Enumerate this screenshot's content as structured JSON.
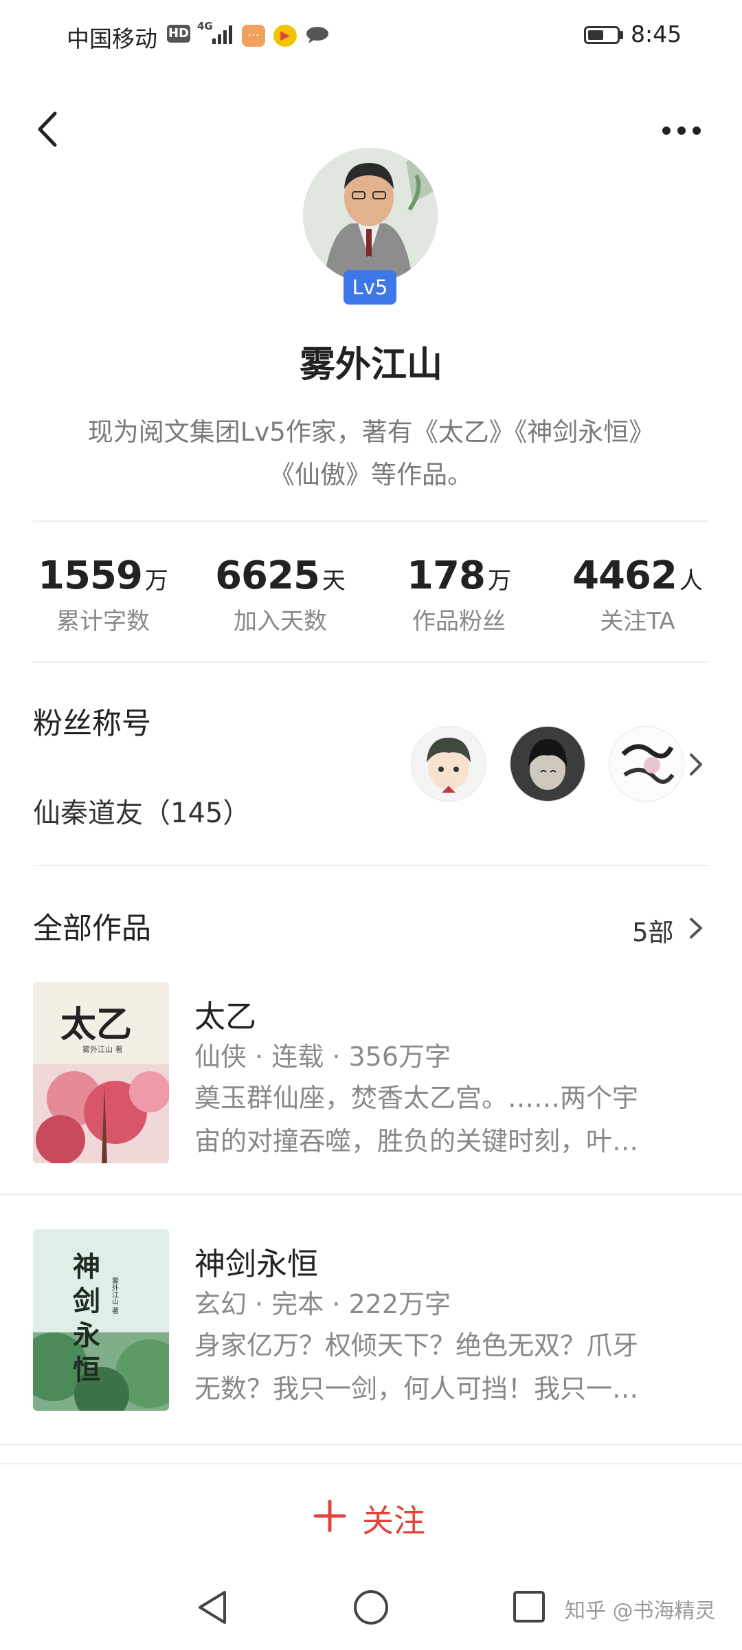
{
  "status_bar": {
    "carrier": "中国移动",
    "hd": "HD",
    "network": "4G",
    "time": "8:45",
    "battery_level": 0.55
  },
  "header": {
    "back_icon": "chevron-left-icon",
    "more_icon": "ellipsis-icon"
  },
  "profile": {
    "level_badge": "Lv5",
    "name": "雾外江山",
    "bio_line1": "现为阅文集团Lv5作家，著有《太乙》《神剑永恒》",
    "bio_line2": "《仙傲》等作品。"
  },
  "stats": [
    {
      "value": "1559",
      "unit": "万",
      "label": "累计字数"
    },
    {
      "value": "6625",
      "unit": "天",
      "label": "加入天数"
    },
    {
      "value": "178",
      "unit": "万",
      "label": "作品粉丝"
    },
    {
      "value": "4462",
      "unit": "人",
      "label": "关注TA"
    }
  ],
  "fans": {
    "title": "粉丝称号",
    "nickname": "仙秦道友（145）"
  },
  "works": {
    "title": "全部作品",
    "count": "5部",
    "books": [
      {
        "title": "太乙",
        "meta": "仙侠 · 连载 · 356万字",
        "desc_line1": "奠玉群仙座，焚香太乙宫。……两个宇",
        "desc_line2": "宙的对撞吞噬，胜负的关键时刻，叶…",
        "cover_title": "太乙",
        "cover_author": "雾外江山 著"
      },
      {
        "title": "神剑永恒",
        "meta": "玄幻 · 完本 · 222万字",
        "desc_line1": "身家亿万？权倾天下？绝色无双？爪牙",
        "desc_line2": "无数？我只一剑，何人可挡！我只一…",
        "cover_title": "神剑永恒",
        "cover_author": "雾外江山 著"
      }
    ]
  },
  "follow": {
    "label": "关注",
    "color": "#e0443b"
  },
  "watermark": "知乎 @书海精灵",
  "colors": {
    "accent": "#e0443b",
    "badge": "#3e78e8",
    "secondary_text": "#888888"
  }
}
